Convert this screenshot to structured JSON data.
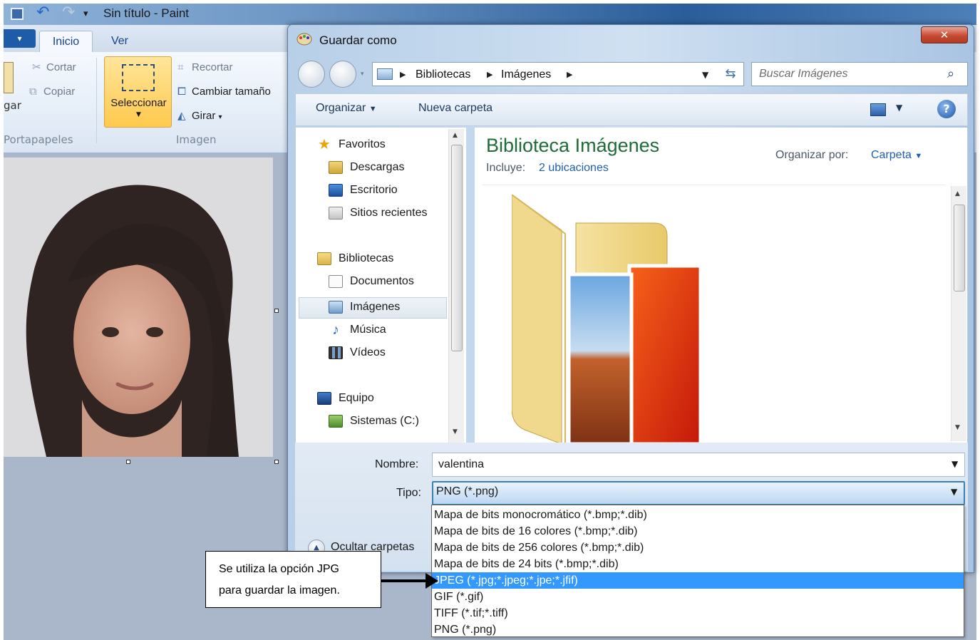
{
  "paint": {
    "title": "Sin título - Paint",
    "tabs": [
      "Inicio",
      "Ver"
    ],
    "clipboard": {
      "cut": "Cortar",
      "copy": "Copiar",
      "paste": "gar",
      "group": "Portapapeles"
    },
    "image": {
      "select": "Seleccionar",
      "crop": "Recortar",
      "resize": "Cambiar tamaño",
      "rotate": "Girar",
      "group": "Imagen"
    }
  },
  "dialog": {
    "title": "Guardar como",
    "breadcrumb": [
      "Bibliotecas",
      "Imágenes"
    ],
    "search_placeholder": "Buscar Imágenes",
    "toolbar": {
      "organize": "Organizar",
      "new_folder": "Nueva carpeta"
    },
    "nav": [
      {
        "label": "Favoritos",
        "icon": "star-icon"
      },
      {
        "label": "Descargas",
        "icon": "downloads-icon"
      },
      {
        "label": "Escritorio",
        "icon": "desktop-icon"
      },
      {
        "label": "Sitios recientes",
        "icon": "recent-places-icon"
      },
      {
        "label": "Bibliotecas",
        "icon": "libraries-icon"
      },
      {
        "label": "Documentos",
        "icon": "documents-icon"
      },
      {
        "label": "Imágenes",
        "icon": "pictures-icon"
      },
      {
        "label": "Música",
        "icon": "music-icon"
      },
      {
        "label": "Vídeos",
        "icon": "videos-icon"
      },
      {
        "label": "Equipo",
        "icon": "computer-icon"
      },
      {
        "label": "Sistemas (C:)",
        "icon": "drive-icon"
      }
    ],
    "library": {
      "title": "Biblioteca Imágenes",
      "includes_label": "Incluye:",
      "includes_link": "2 ubicaciones",
      "arrange_label": "Organizar por:",
      "arrange_value": "Carpeta"
    },
    "filename_label": "Nombre:",
    "filename_value": "valentina",
    "type_label": "Tipo:",
    "type_value": "PNG (*.png)",
    "hide_folders": "Ocultar carpetas",
    "type_options": [
      "Mapa de bits monocromático (*.bmp;*.dib)",
      "Mapa de bits de 16 colores (*.bmp;*.dib)",
      "Mapa de bits de 256 colores (*.bmp;*.dib)",
      "Mapa de bits de 24 bits (*.bmp;*.dib)",
      "JPEG (*.jpg;*.jpeg;*.jpe;*.jfif)",
      "GIF (*.gif)",
      "TIFF (*.tif;*.tiff)",
      "PNG (*.png)"
    ],
    "selected_option": 4
  },
  "annotation": {
    "line1": "Se utiliza la opción JPG",
    "line2": "para guardar la imagen."
  },
  "colors": {
    "library_title": "#1e6c38",
    "link": "#1f5fb0",
    "selection": "#3399ff"
  }
}
